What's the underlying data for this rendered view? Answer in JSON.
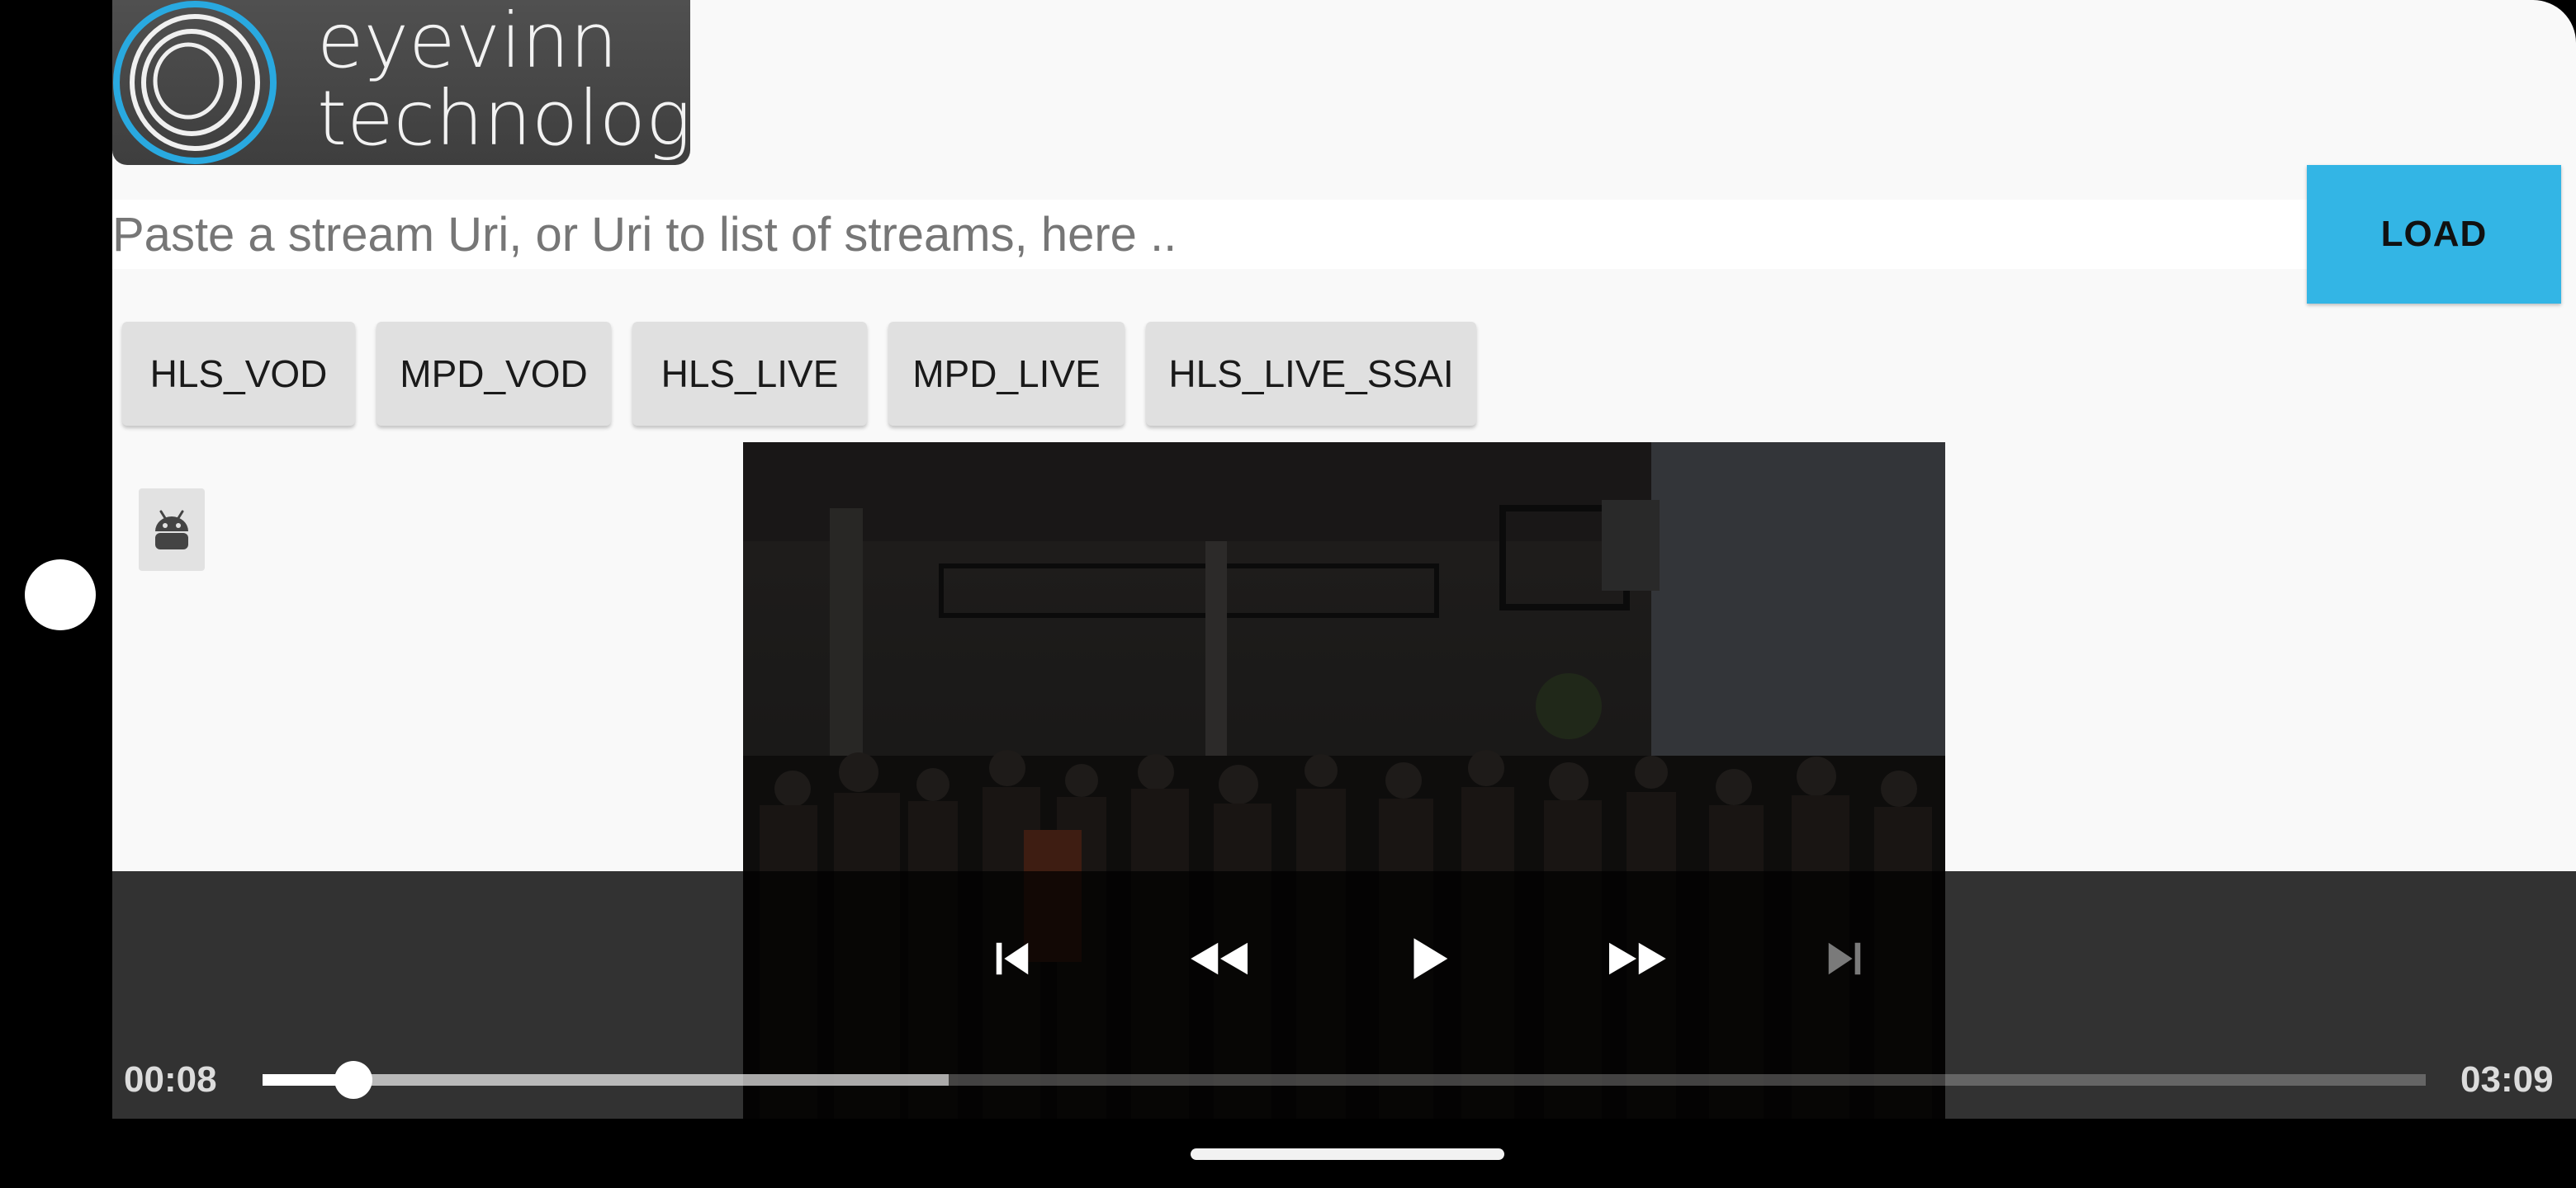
{
  "logo": {
    "line1": "eyevinn",
    "line2": "technology"
  },
  "url_input": {
    "value": "",
    "placeholder": "Paste a stream Uri, or Uri to list of streams, here .."
  },
  "load_button": {
    "label": "LOAD"
  },
  "presets": [
    {
      "label": "HLS_VOD"
    },
    {
      "label": "MPD_VOD"
    },
    {
      "label": "HLS_LIVE"
    },
    {
      "label": "MPD_LIVE"
    },
    {
      "label": "HLS_LIVE_SSAI"
    }
  ],
  "player": {
    "position": "00:08",
    "duration": "03:09",
    "played_fraction": 0.042,
    "buffered_fraction": 0.317
  },
  "icons": {
    "android": "android-icon",
    "previous": "skip-previous-icon",
    "rewind": "rewind-icon",
    "play": "play-icon",
    "fast_forward": "fast-forward-icon",
    "next": "skip-next-icon"
  },
  "colors": {
    "accent": "#33b5e5",
    "logo_ring": "#29a9e0"
  }
}
